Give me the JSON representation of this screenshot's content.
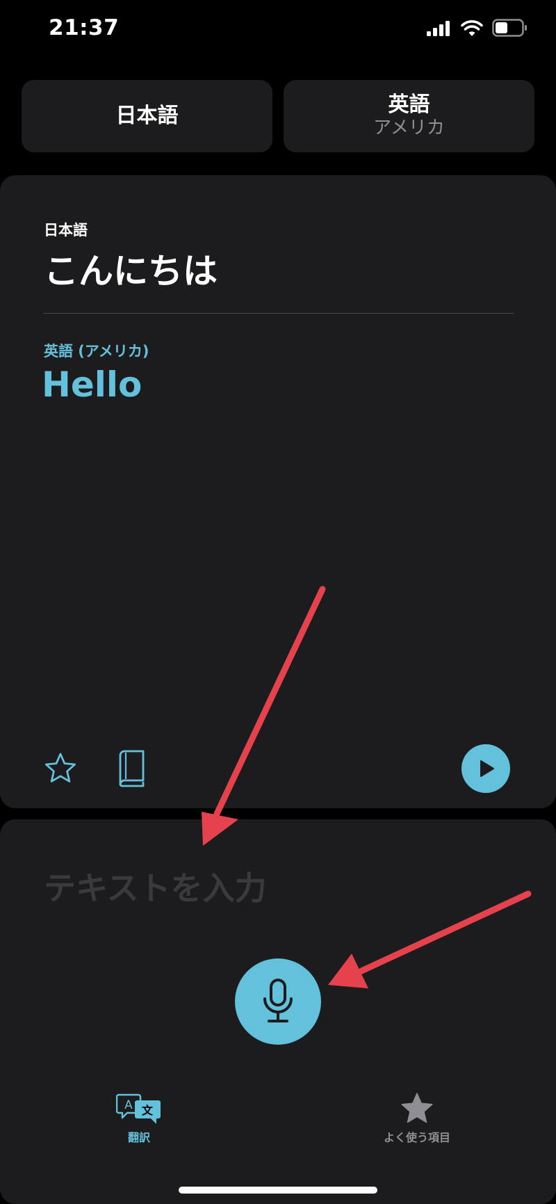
{
  "status_bar": {
    "time": "21:37"
  },
  "language_selector": {
    "source": {
      "name": "日本語"
    },
    "target": {
      "name": "英語",
      "region": "アメリカ"
    }
  },
  "translation": {
    "source_label": "日本語",
    "source_text": "こんにちは",
    "target_label": "英語 (アメリカ)",
    "target_text": "Hello"
  },
  "input": {
    "placeholder": "テキストを入力",
    "value": ""
  },
  "tab_bar": {
    "tabs": [
      {
        "label": "翻訳",
        "icon": "translate-icon",
        "selected": true
      },
      {
        "label": "よく使う項目",
        "icon": "star-icon",
        "selected": false
      }
    ]
  },
  "colors": {
    "accent": "#64c1dc",
    "background": "#000000",
    "card": "#1c1c1e",
    "annotation_arrow": "#e5424d"
  },
  "icons": {
    "favorite": "star-outline-icon",
    "dictionary": "book-icon",
    "play": "play-icon",
    "microphone": "microphone-icon"
  }
}
